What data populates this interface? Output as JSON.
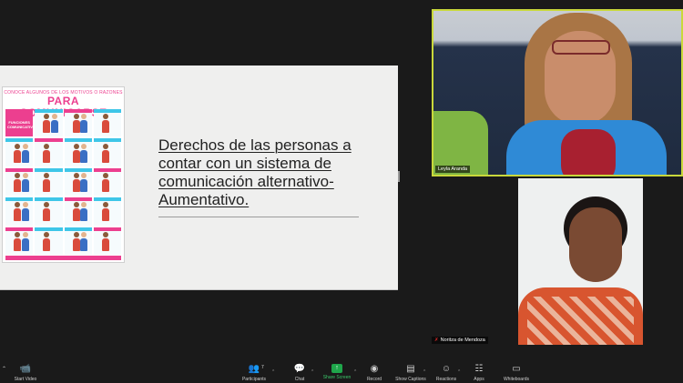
{
  "slide": {
    "poster_subtitle": "CONOCE ALGUNOS DE LOS MOTIVOS O RAZONES",
    "poster_title": "PARA COMUNICARSE",
    "poster_label": "FUNCIONES COMUNICATIVAS",
    "text_lines": [
      "Derechos de las personas a",
      "contar con un sistema de",
      "comunicación alternativo-",
      "Aumentativo."
    ]
  },
  "participants": [
    {
      "name": "Leyla Aranda"
    },
    {
      "name": "Noritza de Mendoza"
    }
  ],
  "toolbar": {
    "start_video": "Start Video",
    "participants": "Participants",
    "participants_count": "7",
    "chat": "Chat",
    "share_screen": "Share Screen",
    "record": "Record",
    "show_captions": "Show Captions",
    "reactions": "Reactions",
    "apps": "Apps",
    "whiteboards": "Whiteboards"
  },
  "colors": {
    "active_speaker_border": "#c9d83b",
    "share_button": "#1fa64b",
    "poster_pink": "#ec3f8f",
    "poster_cyan": "#3ec6e8"
  }
}
